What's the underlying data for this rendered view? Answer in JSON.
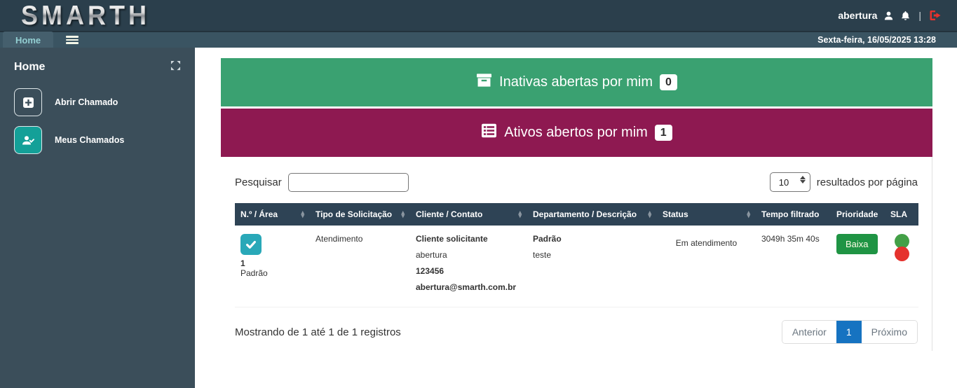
{
  "header": {
    "logo": "SMARTH",
    "username": "abertura",
    "separator": "|",
    "icons": [
      "user-icon",
      "bell-icon",
      "logout-icon"
    ]
  },
  "topbar": {
    "home_tab": "Home",
    "menu_icon": "hamburger-icon",
    "datetime": "Sexta-feira, 16/05/2025 13:28"
  },
  "sidebar": {
    "title": "Home",
    "collapse_icon": "compress-icon",
    "items": [
      {
        "label": "Abrir Chamado",
        "icon": "plus-square-icon"
      },
      {
        "label": "Meus Chamados",
        "icon": "user-check-icon"
      }
    ]
  },
  "banners": {
    "inactive": {
      "label": "Inativas abertas por mim",
      "count": "0",
      "bg": "#3aa171",
      "icon": "archive-icon"
    },
    "active": {
      "label": "Ativos abertos por mim",
      "count": "1",
      "bg": "#8e1951",
      "icon": "list-icon"
    }
  },
  "search": {
    "label": "Pesquisar",
    "value": "",
    "page_size": "10",
    "per_page_label": "resultados por página"
  },
  "table": {
    "columns": [
      "N.º / Área",
      "Tipo de Solicitação",
      "Cliente / Contato",
      "Departamento / Descrição",
      "Status",
      "Tempo filtrado",
      "Prioridade",
      "SLA"
    ],
    "row": {
      "checkbox_icon": "check-icon",
      "number": "1",
      "area": "Padrão",
      "tipo": "Atendimento",
      "cliente": [
        "Cliente solicitante",
        "abertura",
        "123456",
        "abertura@smarth.com.br"
      ],
      "departamento": [
        "Padrão",
        "teste"
      ],
      "status": "Em atendimento",
      "tempo": "3049h 35m 40s",
      "prioridade": "Baixa",
      "prioridade_bg": "#1f9444",
      "sla_colors": [
        "#43a047",
        "#e5322d"
      ]
    }
  },
  "footer": {
    "summary": "Mostrando de 1 até 1 de 1 registros",
    "pagination": {
      "prev": "Anterior",
      "current": "1",
      "next": "Próximo",
      "active_bg": "#1673c1"
    }
  }
}
